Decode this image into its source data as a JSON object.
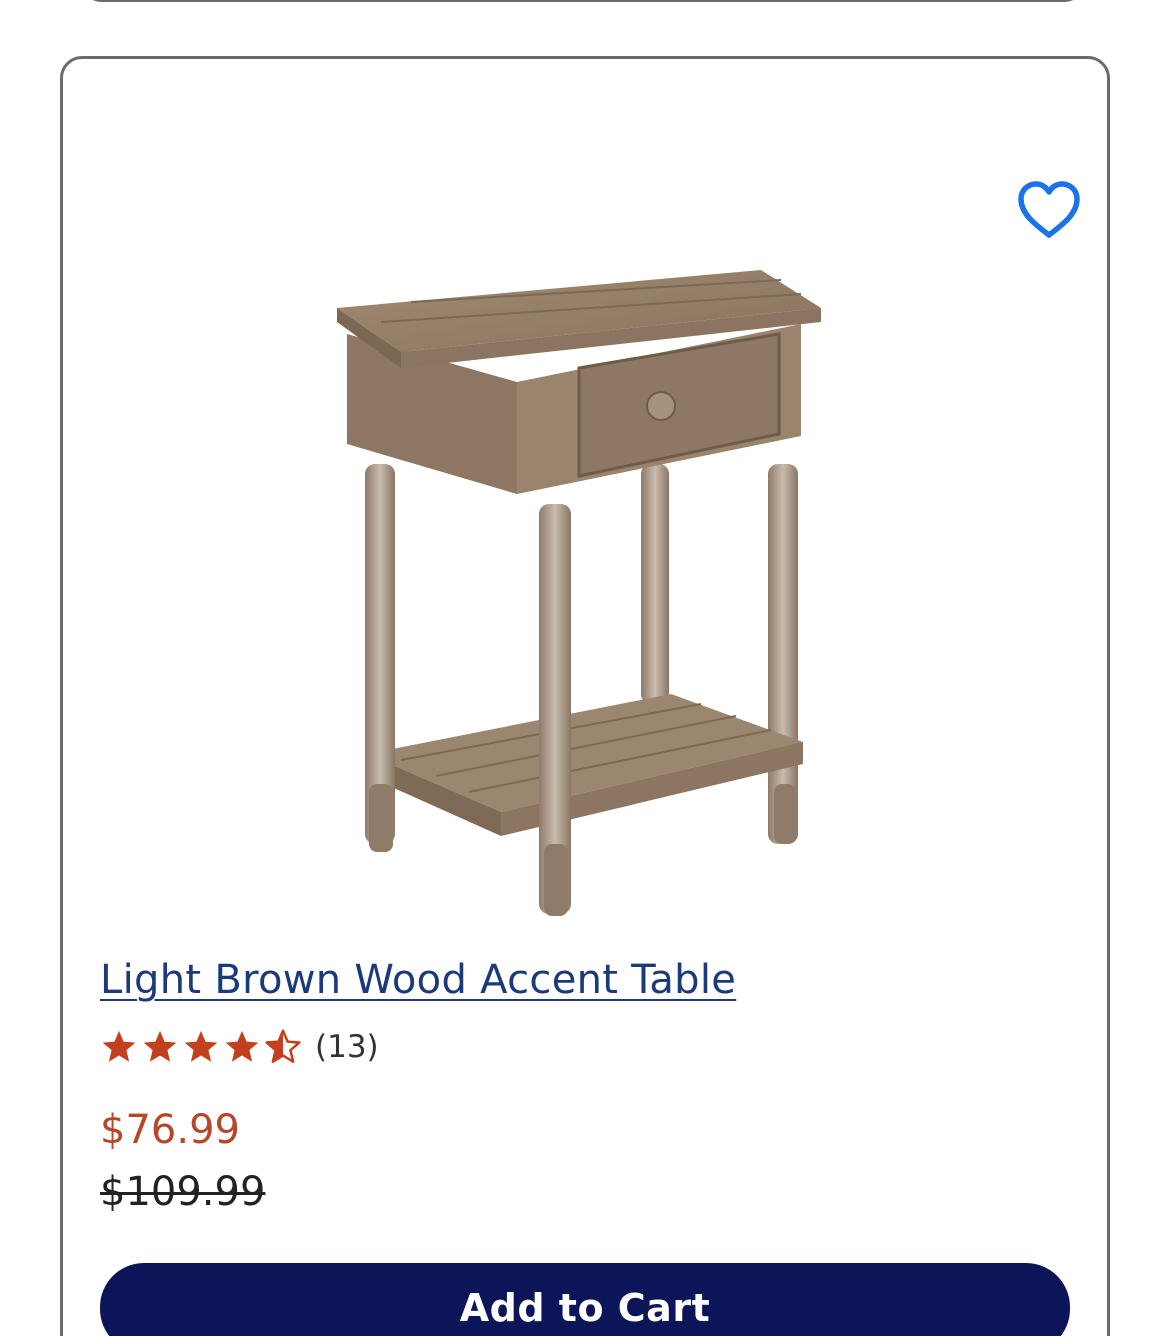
{
  "product": {
    "title": "Light Brown Wood Accent Table",
    "rating_value": 4.5,
    "rating_max": 5,
    "review_count": "(13)",
    "price_sale": "$76.99",
    "price_original": "$109.99",
    "add_to_cart_label": "Add to Cart",
    "favorite_icon": "heart-outline-icon",
    "image_subject": "light-brown-wood-accent-table"
  },
  "colors": {
    "link": "#1b3a7a",
    "sale_price": "#b5482a",
    "star": "#c2401e",
    "button_bg": "#0b1558",
    "favorite_icon": "#1a73e8"
  }
}
